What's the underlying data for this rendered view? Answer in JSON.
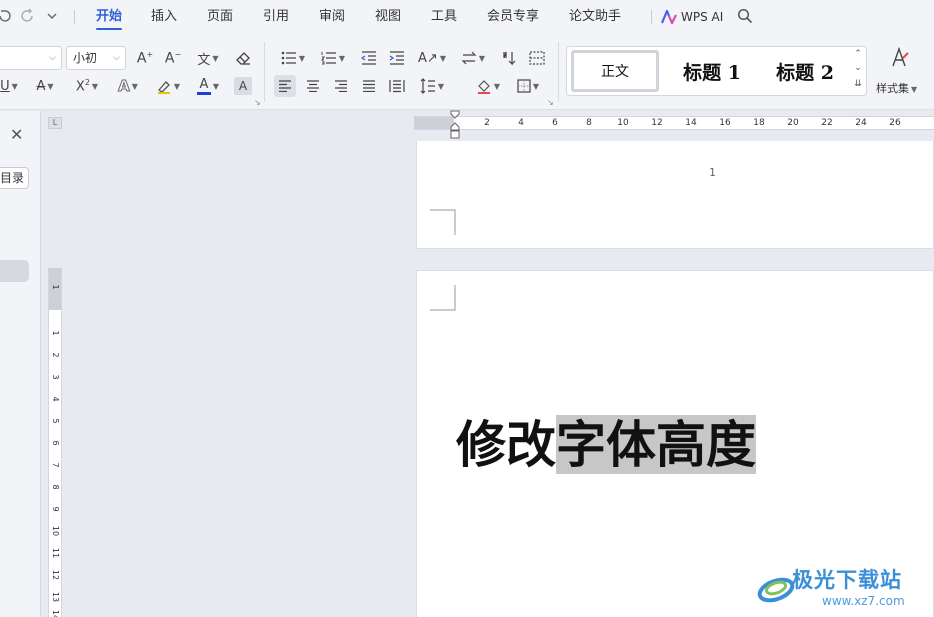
{
  "menu": {
    "tabs": [
      "开始",
      "插入",
      "页面",
      "引用",
      "审阅",
      "视图",
      "工具",
      "会员专享",
      "论文助手"
    ],
    "active_tab": "开始",
    "wps_ai": "WPS AI"
  },
  "ribbon": {
    "font_family_value": "",
    "font_size_value": "小初",
    "styles": {
      "normal": "正文",
      "heading1": "标题 1",
      "heading2": "标题 2",
      "style_set": "样式集"
    }
  },
  "nav_pane": {
    "toc_button": "目录"
  },
  "ruler": {
    "horizontal_ticks": [
      "2",
      "4",
      "6",
      "8",
      "10",
      "12",
      "14",
      "16",
      "18",
      "20",
      "22",
      "24",
      "26"
    ],
    "vertical_ticks": [
      "1",
      "1",
      "2",
      "3",
      "4",
      "5",
      "6",
      "7",
      "8",
      "9",
      "10",
      "11",
      "12",
      "13",
      "14"
    ],
    "corner_label": "L"
  },
  "document": {
    "page_number": "1",
    "text_plain": "修改",
    "text_selected": "字体高度"
  },
  "watermark": {
    "name": "极光下载站",
    "url": "www.xz7.com"
  },
  "colors": {
    "accent": "#2f5fd8",
    "selection": "#c7c7c7",
    "font_color_bar": "#1f3fcf"
  }
}
